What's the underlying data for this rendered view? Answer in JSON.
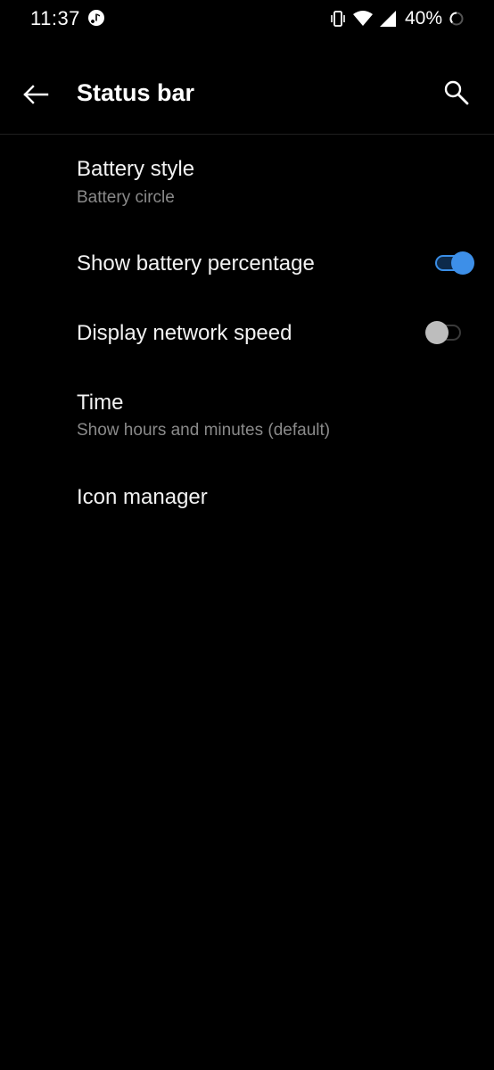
{
  "status_bar": {
    "time": "11:37",
    "battery_percent": "40%",
    "notification_icon": "music-note-icon",
    "icons": [
      "vibrate-icon",
      "wifi-icon",
      "cell-signal-icon",
      "battery-circle-icon"
    ]
  },
  "app_bar": {
    "title": "Status bar",
    "back_icon": "back-arrow-icon",
    "search_icon": "search-icon"
  },
  "settings": {
    "battery_style": {
      "title": "Battery style",
      "summary": "Battery circle"
    },
    "show_battery_percentage": {
      "title": "Show battery percentage",
      "enabled": true
    },
    "display_network_speed": {
      "title": "Display network speed",
      "enabled": false
    },
    "time": {
      "title": "Time",
      "summary": "Show hours and minutes (default)"
    },
    "icon_manager": {
      "title": "Icon manager"
    }
  },
  "colors": {
    "background": "#000000",
    "accent": "#3d8fe8",
    "primary_text": "#f2f2f2",
    "secondary_text": "#8a8a8a"
  }
}
